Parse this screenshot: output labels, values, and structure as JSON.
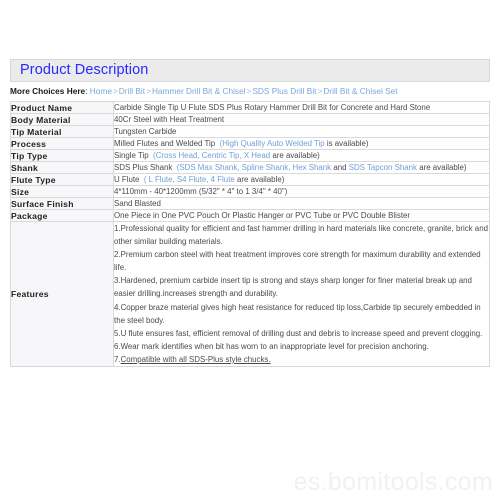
{
  "section": {
    "title": "Product Description"
  },
  "breadcrumb": {
    "label": "More Choices Here",
    "colon": ":",
    "separator": ">",
    "items": [
      "Home",
      "Drill Bit",
      "Hammer Drill Bit & Chisel",
      "SDS Plus Drill Bit",
      "Drill Bit & Chisel Set"
    ]
  },
  "spec_table": {
    "rows": [
      {
        "label": "Product Name",
        "value_plain": "Carbide Single Tip U Flute SDS Plus Rotary Hammer Drill Bit for Concrete and Hard Stone"
      },
      {
        "label": "Body Material",
        "value_plain": "40Cr Steel with Heat Treatment"
      },
      {
        "label": "Tip Material",
        "value_plain": "Tungsten Carbide"
      },
      {
        "label": "Process",
        "value_plain": "Milled Flutes and Welded Tip",
        "paren_open": "(",
        "options": "High Quality Auto Welded Tip",
        "paren_tail": " is available)"
      },
      {
        "label": "Tip Type",
        "value_plain": "Single Tip",
        "paren_open": "(",
        "options": "Cross Head, Centric Tip, X Head",
        "paren_tail": " are available)"
      },
      {
        "label": "Shank",
        "value_plain": "SDS Plus Shank",
        "paren_open": "(",
        "options": "SDS Max Shank, Spline Shank, Hex Shank",
        "mid_plain": " and ",
        "options2": "SDS Tapcon Shank",
        "paren_tail": " are available)"
      },
      {
        "label": "Flute Type",
        "value_plain": "U Flute",
        "paren_open": "(",
        "options": "L Flute, S4 Flute, 4 Flute",
        "paren_tail": " are available)"
      },
      {
        "label": "Size",
        "value_plain": "4*110mm - 40*1200mm  (5/32\" * 4\" to 1 3/4\" * 40\")"
      },
      {
        "label": "Surface Finish",
        "value_plain": "Sand Blasted"
      },
      {
        "label": "Package",
        "value_plain": "One Piece in One PVC Pouch Or Plastic Hanger or PVC Tube or PVC Double Blister"
      }
    ],
    "features": {
      "label": "Features",
      "items": [
        "1.Professional quality for efficient and fast hammer drilling in hard materials like concrete, granite, brick and other similar building materials.",
        "2.Premium carbon steel with heat treatment improves core strength for maximum durability and extended life.",
        "3.Hardened, premium carbide insert tip is strong and stays sharp longer for finer material break up and easier drilling.increases strength and durability.",
        "4.Copper braze material gives high heat resistance for reduced tip loss,Carbide tip securely embedded in the steel body.",
        "5.U flute ensures fast, efficient removal of drilling dust and debris to increase speed and prevent clogging.",
        "6.Wear mark identifies when bit has worn to an inappropriate level for precision anchoring."
      ],
      "last_item_number": "7.",
      "last_item_underlined": "Compatible with all SDS-Plus style chucks."
    }
  },
  "watermark": {
    "text": "es.bomitools.com"
  },
  "colors": {
    "header_text": "#2b27ff",
    "header_bg": "#ebebeb",
    "link": "#7ba7d7",
    "option_link": "#6f9fd8",
    "label_bg": "#f7f7f9",
    "body_text": "#4a4a52",
    "border": "#d9d9d9",
    "watermark": "#f1f1f1"
  }
}
